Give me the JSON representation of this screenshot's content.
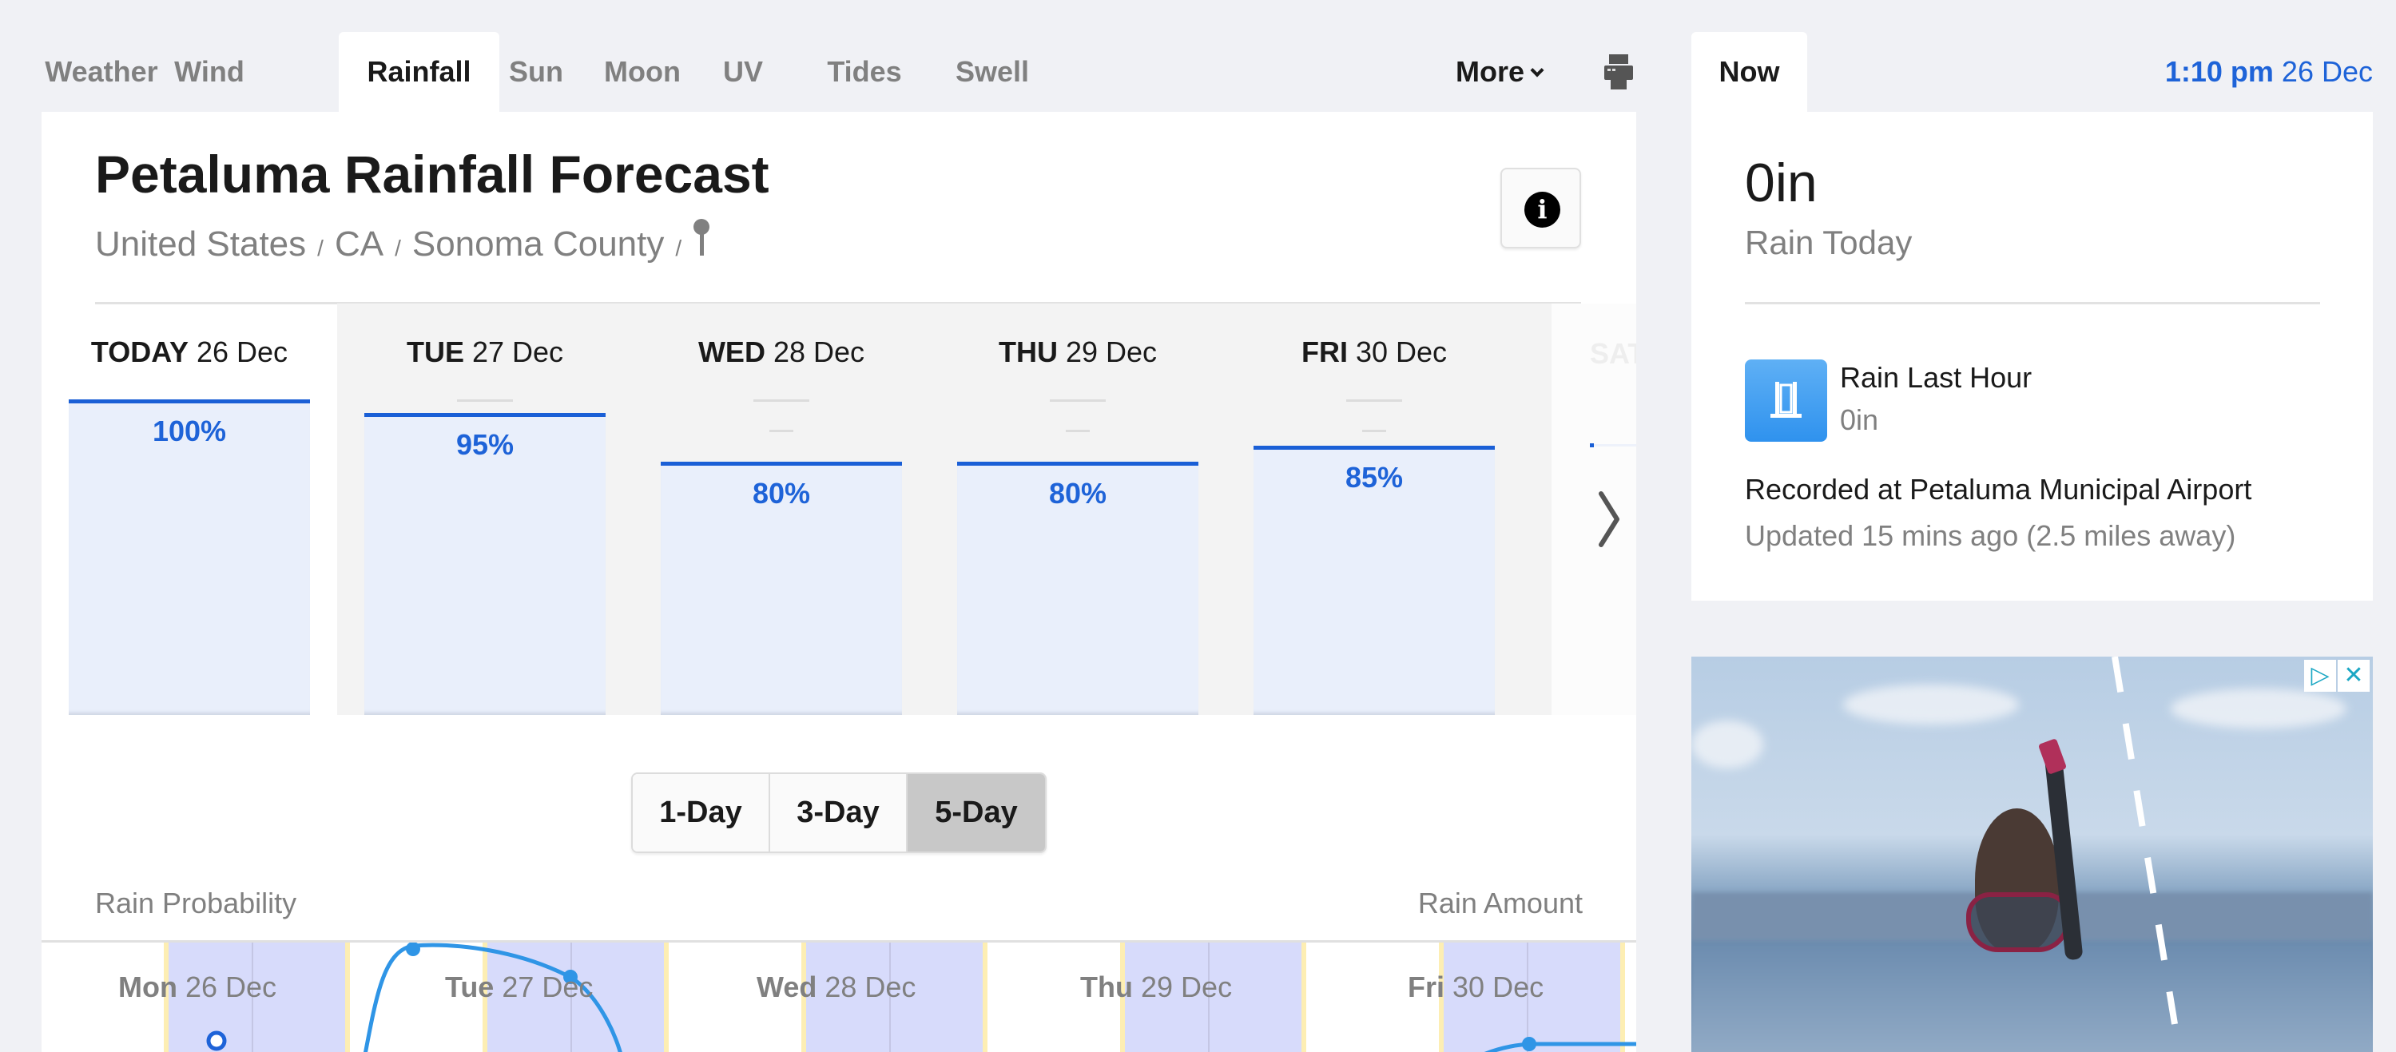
{
  "nav": {
    "tabs": [
      {
        "label": "Weather",
        "active": false
      },
      {
        "label": "Wind",
        "active": false
      },
      {
        "label": "Rainfall",
        "active": true
      },
      {
        "label": "Sun",
        "active": false
      },
      {
        "label": "Moon",
        "active": false
      },
      {
        "label": "UV",
        "active": false
      },
      {
        "label": "Tides",
        "active": false
      },
      {
        "label": "Swell",
        "active": false
      }
    ],
    "more_label": "More",
    "print_icon": "printer-icon"
  },
  "header": {
    "location": "Petaluma",
    "title_rest": "Rainfall Forecast",
    "breadcrumbs": [
      "United States",
      "CA",
      "Sonoma County"
    ],
    "separator": "/",
    "pin_icon": "location-pin-icon",
    "info_icon": "info-icon",
    "info_glyph": "i"
  },
  "forecast": {
    "days": [
      {
        "dow": "TODAY",
        "date": "26 Dec",
        "probability_pct": 100,
        "label": "100%",
        "amount": "",
        "selected": true
      },
      {
        "dow": "TUE",
        "date": "27 Dec",
        "probability_pct": 95,
        "label": "95%",
        "amount": "—",
        "selected": false
      },
      {
        "dow": "WED",
        "date": "28 Dec",
        "probability_pct": 80,
        "label": "80%",
        "amount": "—",
        "selected": false
      },
      {
        "dow": "THU",
        "date": "29 Dec",
        "probability_pct": 80,
        "label": "80%",
        "amount": "—",
        "selected": false
      },
      {
        "dow": "FRI",
        "date": "30 Dec",
        "probability_pct": 85,
        "label": "85%",
        "amount": "—",
        "selected": false
      }
    ],
    "partial_next_day": "SAT",
    "next_icon": "chevron-right-icon",
    "accent_color": "#1e63d8"
  },
  "range": {
    "options": [
      "1-Day",
      "3-Day",
      "5-Day"
    ],
    "selected": "5-Day"
  },
  "chart": {
    "left_label": "Rain Probability",
    "right_label": "Rain Amount",
    "days": [
      {
        "dow": "Mon",
        "date": "26 Dec"
      },
      {
        "dow": "Tue",
        "date": "27 Dec"
      },
      {
        "dow": "Wed",
        "date": "28 Dec"
      },
      {
        "dow": "Thu",
        "date": "29 Dec"
      },
      {
        "dow": "Fri",
        "date": "30 Dec"
      }
    ],
    "night_color": "#d7dbfb",
    "day_color": "#ffffff",
    "sun_line_color": "#fdeeb3",
    "line_color": "#2f95e6"
  },
  "now": {
    "tab_label": "Now",
    "time": "1:10 pm",
    "date": "26 Dec",
    "rain_today_value": "0in",
    "rain_today_label": "Rain Today",
    "rain_last_hour_label": "Rain Last Hour",
    "rain_last_hour_value": "0in",
    "gauge_icon": "rain-gauge-icon",
    "recorded_at": "Recorded at Petaluma Municipal Airport",
    "updated": "Updated 15 mins ago (2.5 miles away)"
  },
  "ad": {
    "adchoices_icon": "adchoices-icon",
    "close_icon": "close-icon",
    "close_glyph": "✕",
    "adchoices_glyph": "▷"
  }
}
